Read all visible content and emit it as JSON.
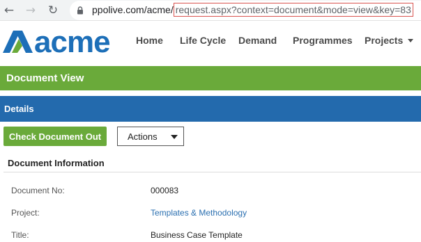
{
  "browser": {
    "url_host": "ppolive.com/acme/",
    "url_path": "request.aspx?context=document&mode=view&key=83"
  },
  "header": {
    "logo_text": "acme",
    "nav": [
      {
        "label": "Home"
      },
      {
        "label": "Life Cycle"
      },
      {
        "label": "Demand"
      },
      {
        "label": "Programmes"
      },
      {
        "label": "Projects"
      }
    ]
  },
  "page": {
    "title": "Document View",
    "section": "Details"
  },
  "toolbar": {
    "checkout_label": "Check Document Out",
    "actions_label": "Actions"
  },
  "document_info": {
    "title": "Document Information",
    "fields": [
      {
        "label": "Document No:",
        "value": "000083"
      },
      {
        "label": "Project:",
        "value": "Templates & Methodology"
      },
      {
        "label": "Title:",
        "value": "Business Case Template"
      }
    ]
  },
  "colors": {
    "green": "#6aaa3a",
    "blue": "#236aad",
    "logo_blue": "#1d6fb8",
    "link": "#2a6fb0",
    "url_highlight": "#d9534f"
  }
}
